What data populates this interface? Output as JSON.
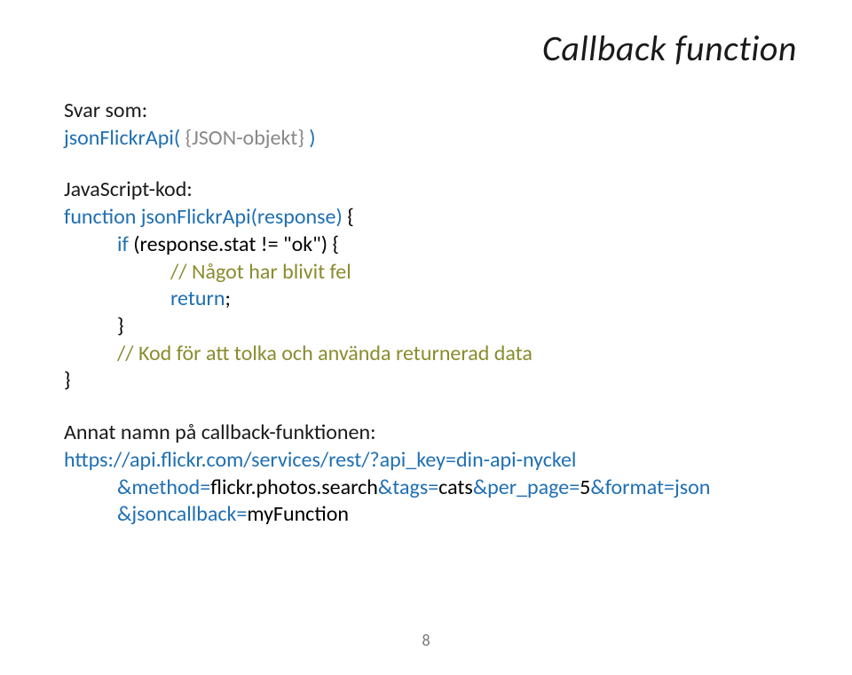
{
  "title": "Callback function",
  "page_number": "8",
  "lines": {
    "l0": "Svar som:",
    "l1a": "jsonFlickrApi(",
    "l1b": " {JSON-objekt} ",
    "l1c": ")",
    "l2": "JavaScript-kod:",
    "l3a": "function jsonFlickrApi(response)",
    "l3b": " {",
    "l4a": "if ",
    "l4b": "(response.stat != \"ok\")",
    "l4c": " {",
    "l5": "// Något har blivit fel",
    "l6a": "return",
    "l6b": ";",
    "l7": "}",
    "l8": "// Kod för att tolka och använda returnerad data",
    "l9": "}",
    "l10": "Annat namn på callback-funktionen:",
    "l11": "https://api.flickr.com/services/rest/?api_key=din-api-nyckel",
    "l12a": "&method=",
    "l12b": "flickr.photos.search",
    "l12c": "&tags=",
    "l12d": "cats",
    "l12e": "&per_page=",
    "l12f": "5",
    "l12g": "&format=json",
    "l13a": "&jsoncallback=",
    "l13b": "myFunction"
  }
}
